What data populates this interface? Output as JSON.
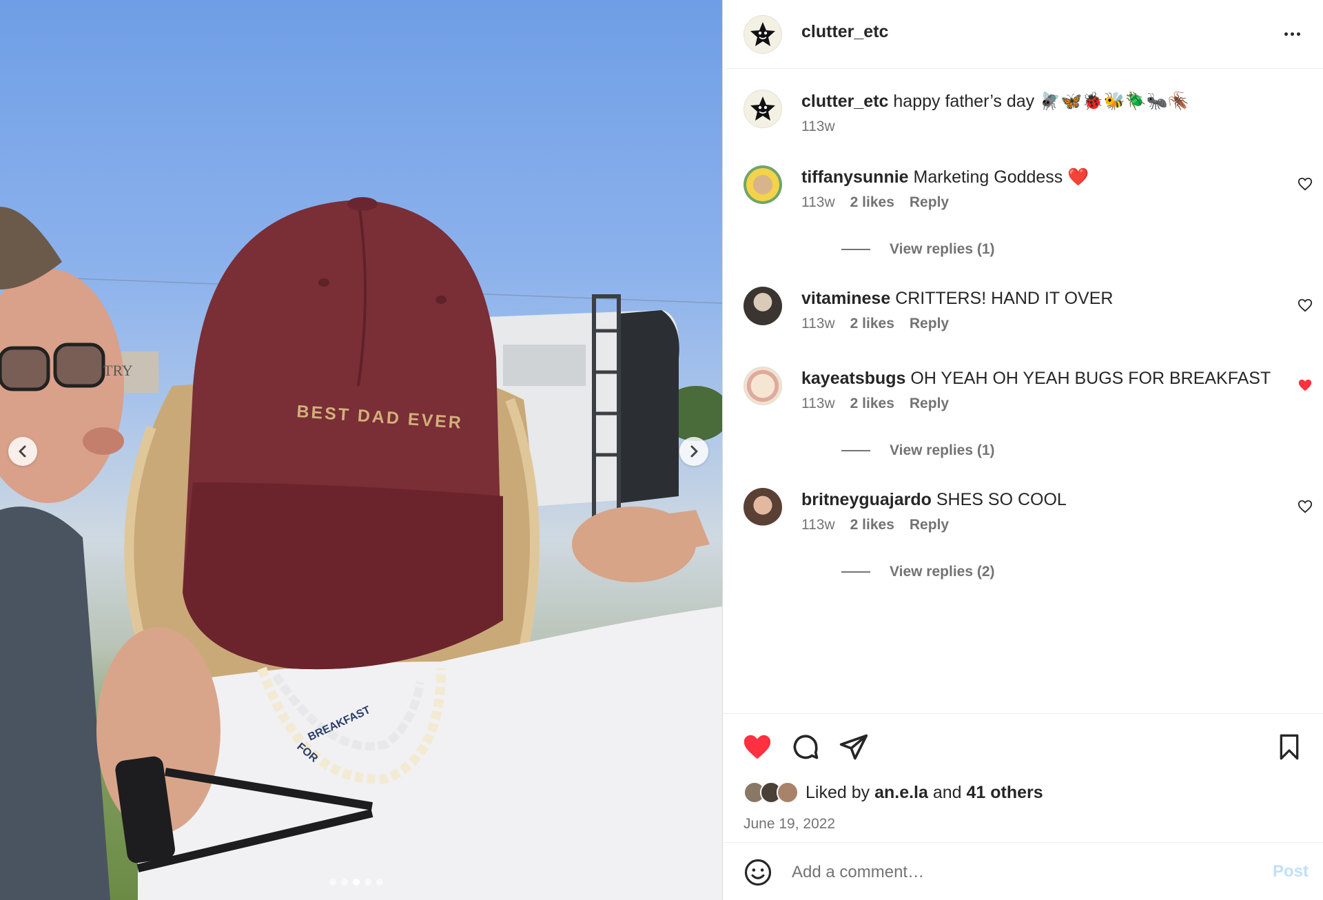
{
  "post": {
    "username": "clutter_etc",
    "more_label": "More options",
    "carousel": {
      "total": 5,
      "active_index": 2
    }
  },
  "caption": {
    "username": "clutter_etc",
    "text": "happy father’s day",
    "emoji": "🪰🦋🐞🐝🪲🐜🪳",
    "time": "113w"
  },
  "photo": {
    "cap_text": "BEST DAD EVER",
    "necklace_text_1": "FOR",
    "necklace_text_2": "BREAKFAST",
    "sign_text": "TRY"
  },
  "comments": [
    {
      "username": "tiffanysunnie",
      "text": "Marketing Goddess",
      "emoji": "❤️",
      "time": "113w",
      "likes": "2 likes",
      "reply": "Reply",
      "liked": false,
      "view_replies": "View replies (1)"
    },
    {
      "username": "vitaminese",
      "text": "CRITTERS! HAND IT OVER",
      "emoji": "",
      "time": "113w",
      "likes": "2 likes",
      "reply": "Reply",
      "liked": false,
      "view_replies": ""
    },
    {
      "username": "kayeatsbugs",
      "text": "OH YEAH OH YEAH BUGS FOR BREAKFAST",
      "emoji": "",
      "time": "113w",
      "likes": "2 likes",
      "reply": "Reply",
      "liked": true,
      "view_replies": "View replies (1)"
    },
    {
      "username": "britneyguajardo",
      "text": "SHES SO COOL",
      "emoji": "",
      "time": "113w",
      "likes": "2 likes",
      "reply": "Reply",
      "liked": false,
      "view_replies": "View replies (2)"
    }
  ],
  "likes": {
    "prefix": "Liked by",
    "user": "an.e.la",
    "and": "and",
    "others": "41 others",
    "date": "June 19, 2022"
  },
  "composer": {
    "placeholder": "Add a comment…",
    "post_label": "Post"
  },
  "colors": {
    "heart_red": "#ff3040",
    "post_disabled": "#c0dffd",
    "meta_gray": "#737373"
  },
  "icons": [
    "chevron-left-icon",
    "chevron-right-icon",
    "more-icon",
    "heart-icon",
    "comment-icon",
    "share-icon",
    "bookmark-icon",
    "emoji-icon"
  ]
}
